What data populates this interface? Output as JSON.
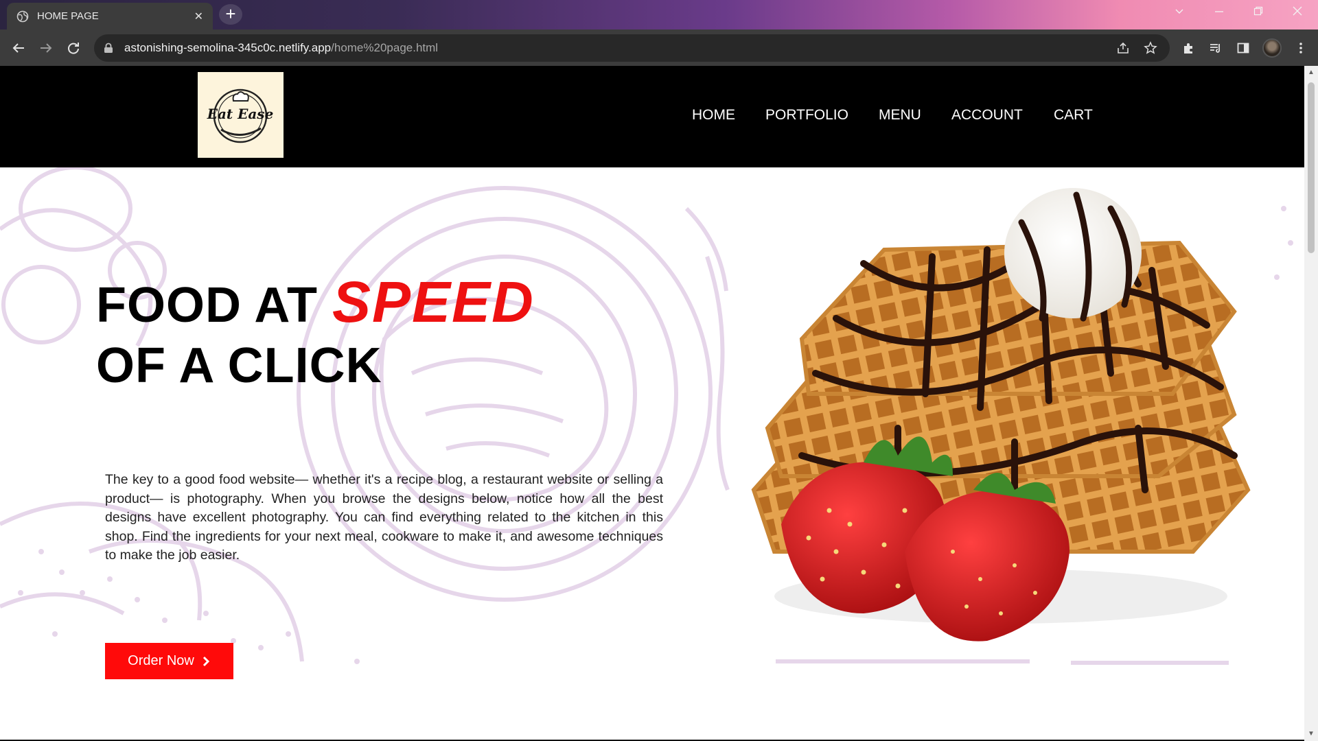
{
  "browser": {
    "tab_title": "HOME PAGE",
    "tab_close": "✕",
    "new_tab": "+",
    "url_host": "astonishing-semolina-345c0c.netlify.app",
    "url_path": "/home%20page.html"
  },
  "site": {
    "logo_text": "Eat Ease",
    "nav": [
      "HOME",
      "PORTFOLIO",
      "MENU",
      "ACCOUNT",
      "CART"
    ]
  },
  "hero": {
    "title_line1_prefix": "FOOD AT ",
    "title_highlight": "SPEED",
    "title_line2": "OF A CLICK",
    "description": "The key to a good food website— whether it's a recipe blog, a restaurant website or selling a product— is photography. When you browse the designs below, notice how all the best designs have excellent photography. You can find everything related to the kitchen in this shop. Find the ingredients for your next meal, cookware to make it, and awesome techniques to make the job easier.",
    "cta_label": "Order Now",
    "cta_icon": "chevron-right-icon"
  },
  "colors": {
    "accent": "#ff0a0a",
    "header_bg": "#000000",
    "logo_bg": "#fdf4dc"
  }
}
